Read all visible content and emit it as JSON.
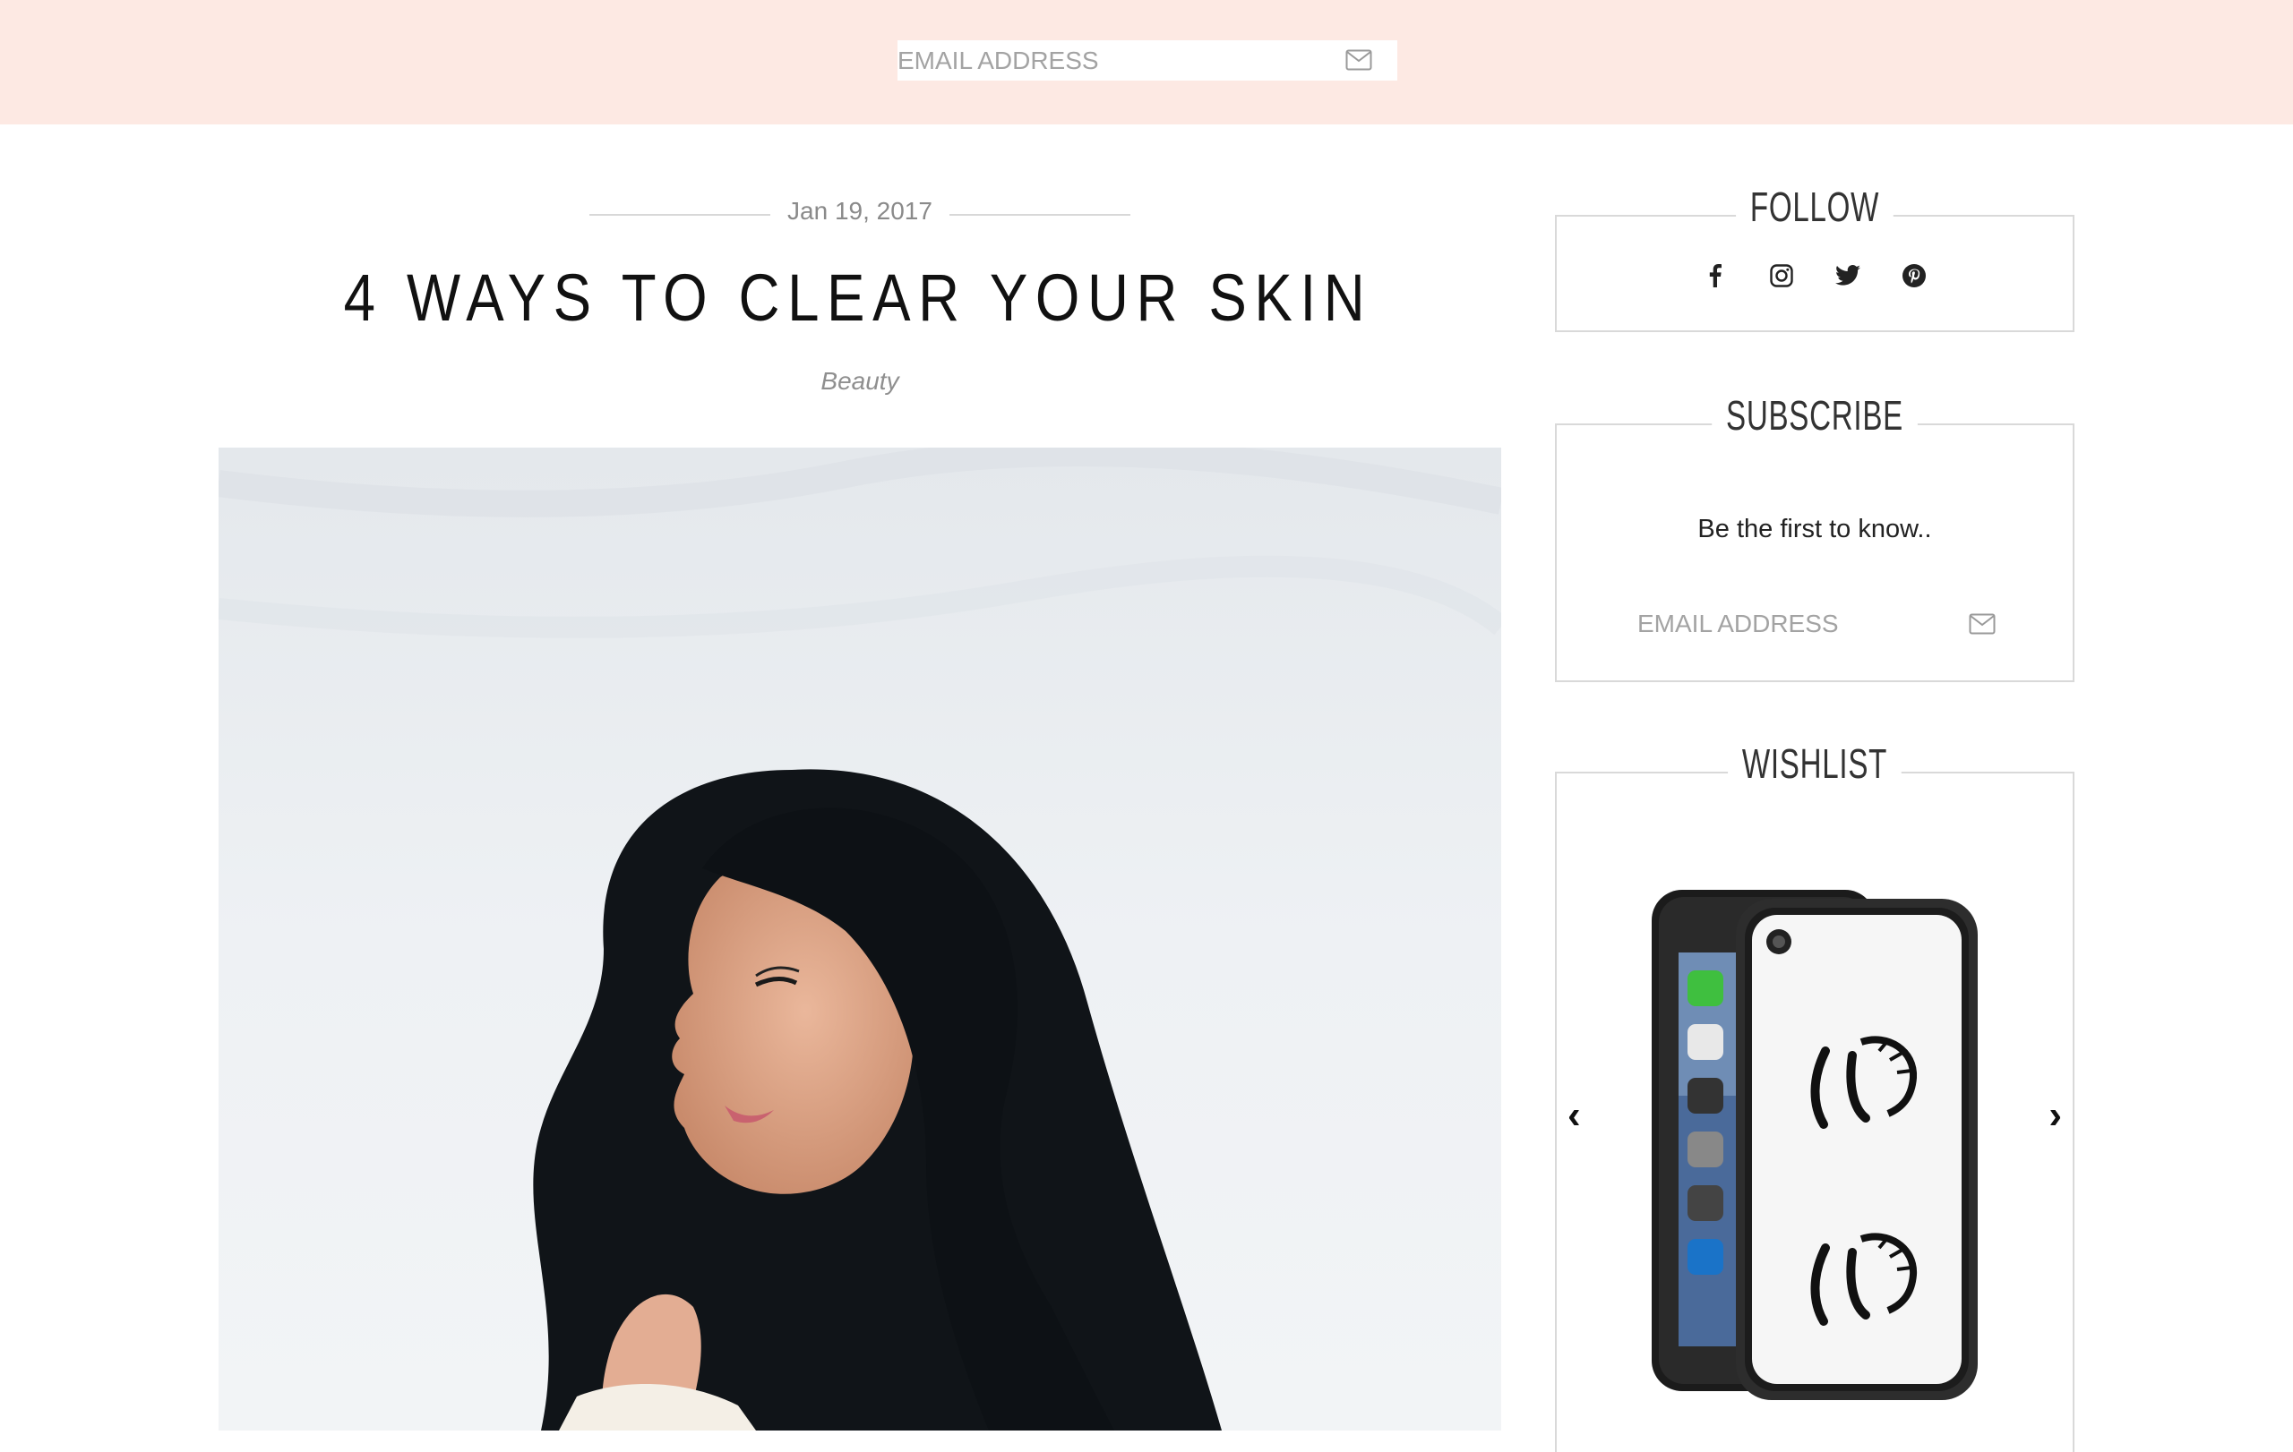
{
  "topbar": {
    "email_placeholder": "EMAIL ADDRESS",
    "mail_icon": "envelope-icon",
    "background_color": "#fde9e3"
  },
  "post": {
    "date": "Jan 19, 2017",
    "title": "4 WAYS TO CLEAR YOUR SKIN",
    "category": "Beauty",
    "hero_image": "woman-smiling-portrait"
  },
  "sidebar": {
    "follow": {
      "title": "FOLLOW",
      "icons": [
        "facebook-icon",
        "instagram-icon",
        "twitter-icon",
        "pinterest-icon"
      ]
    },
    "subscribe": {
      "title": "SUBSCRIBE",
      "text": "Be the first to know..",
      "email_placeholder": "EMAIL ADDRESS",
      "mail_icon": "envelope-icon"
    },
    "wishlist": {
      "title": "WISHLIST",
      "prev_label": "‹",
      "next_label": "›",
      "product_image": "phone-case-lashes"
    }
  }
}
